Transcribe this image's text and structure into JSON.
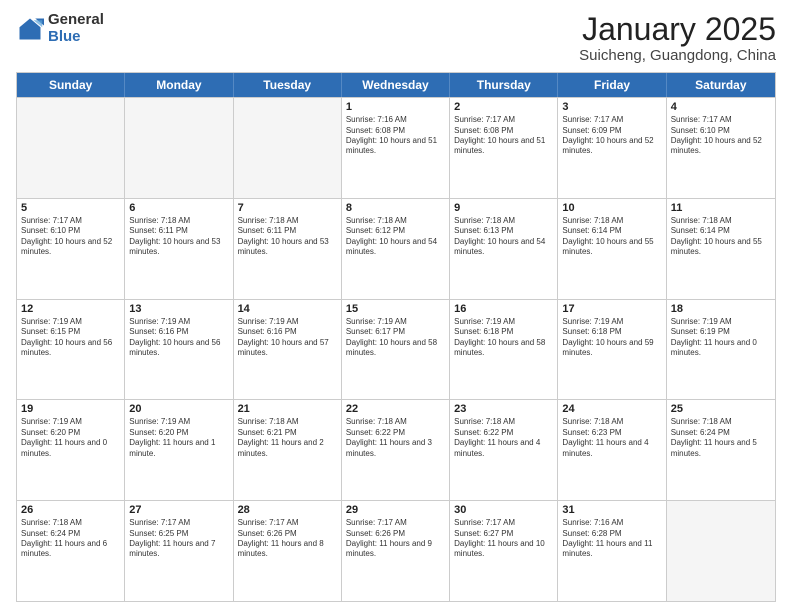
{
  "header": {
    "logo": {
      "general": "General",
      "blue": "Blue"
    },
    "title": "January 2025",
    "subtitle": "Suicheng, Guangdong, China"
  },
  "weekdays": [
    "Sunday",
    "Monday",
    "Tuesday",
    "Wednesday",
    "Thursday",
    "Friday",
    "Saturday"
  ],
  "weeks": [
    [
      {
        "day": "",
        "sunrise": "",
        "sunset": "",
        "daylight": "",
        "empty": true
      },
      {
        "day": "",
        "sunrise": "",
        "sunset": "",
        "daylight": "",
        "empty": true
      },
      {
        "day": "",
        "sunrise": "",
        "sunset": "",
        "daylight": "",
        "empty": true
      },
      {
        "day": "1",
        "sunrise": "Sunrise: 7:16 AM",
        "sunset": "Sunset: 6:08 PM",
        "daylight": "Daylight: 10 hours and 51 minutes.",
        "empty": false
      },
      {
        "day": "2",
        "sunrise": "Sunrise: 7:17 AM",
        "sunset": "Sunset: 6:08 PM",
        "daylight": "Daylight: 10 hours and 51 minutes.",
        "empty": false
      },
      {
        "day": "3",
        "sunrise": "Sunrise: 7:17 AM",
        "sunset": "Sunset: 6:09 PM",
        "daylight": "Daylight: 10 hours and 52 minutes.",
        "empty": false
      },
      {
        "day": "4",
        "sunrise": "Sunrise: 7:17 AM",
        "sunset": "Sunset: 6:10 PM",
        "daylight": "Daylight: 10 hours and 52 minutes.",
        "empty": false
      }
    ],
    [
      {
        "day": "5",
        "sunrise": "Sunrise: 7:17 AM",
        "sunset": "Sunset: 6:10 PM",
        "daylight": "Daylight: 10 hours and 52 minutes.",
        "empty": false
      },
      {
        "day": "6",
        "sunrise": "Sunrise: 7:18 AM",
        "sunset": "Sunset: 6:11 PM",
        "daylight": "Daylight: 10 hours and 53 minutes.",
        "empty": false
      },
      {
        "day": "7",
        "sunrise": "Sunrise: 7:18 AM",
        "sunset": "Sunset: 6:11 PM",
        "daylight": "Daylight: 10 hours and 53 minutes.",
        "empty": false
      },
      {
        "day": "8",
        "sunrise": "Sunrise: 7:18 AM",
        "sunset": "Sunset: 6:12 PM",
        "daylight": "Daylight: 10 hours and 54 minutes.",
        "empty": false
      },
      {
        "day": "9",
        "sunrise": "Sunrise: 7:18 AM",
        "sunset": "Sunset: 6:13 PM",
        "daylight": "Daylight: 10 hours and 54 minutes.",
        "empty": false
      },
      {
        "day": "10",
        "sunrise": "Sunrise: 7:18 AM",
        "sunset": "Sunset: 6:14 PM",
        "daylight": "Daylight: 10 hours and 55 minutes.",
        "empty": false
      },
      {
        "day": "11",
        "sunrise": "Sunrise: 7:18 AM",
        "sunset": "Sunset: 6:14 PM",
        "daylight": "Daylight: 10 hours and 55 minutes.",
        "empty": false
      }
    ],
    [
      {
        "day": "12",
        "sunrise": "Sunrise: 7:19 AM",
        "sunset": "Sunset: 6:15 PM",
        "daylight": "Daylight: 10 hours and 56 minutes.",
        "empty": false
      },
      {
        "day": "13",
        "sunrise": "Sunrise: 7:19 AM",
        "sunset": "Sunset: 6:16 PM",
        "daylight": "Daylight: 10 hours and 56 minutes.",
        "empty": false
      },
      {
        "day": "14",
        "sunrise": "Sunrise: 7:19 AM",
        "sunset": "Sunset: 6:16 PM",
        "daylight": "Daylight: 10 hours and 57 minutes.",
        "empty": false
      },
      {
        "day": "15",
        "sunrise": "Sunrise: 7:19 AM",
        "sunset": "Sunset: 6:17 PM",
        "daylight": "Daylight: 10 hours and 58 minutes.",
        "empty": false
      },
      {
        "day": "16",
        "sunrise": "Sunrise: 7:19 AM",
        "sunset": "Sunset: 6:18 PM",
        "daylight": "Daylight: 10 hours and 58 minutes.",
        "empty": false
      },
      {
        "day": "17",
        "sunrise": "Sunrise: 7:19 AM",
        "sunset": "Sunset: 6:18 PM",
        "daylight": "Daylight: 10 hours and 59 minutes.",
        "empty": false
      },
      {
        "day": "18",
        "sunrise": "Sunrise: 7:19 AM",
        "sunset": "Sunset: 6:19 PM",
        "daylight": "Daylight: 11 hours and 0 minutes.",
        "empty": false
      }
    ],
    [
      {
        "day": "19",
        "sunrise": "Sunrise: 7:19 AM",
        "sunset": "Sunset: 6:20 PM",
        "daylight": "Daylight: 11 hours and 0 minutes.",
        "empty": false
      },
      {
        "day": "20",
        "sunrise": "Sunrise: 7:19 AM",
        "sunset": "Sunset: 6:20 PM",
        "daylight": "Daylight: 11 hours and 1 minute.",
        "empty": false
      },
      {
        "day": "21",
        "sunrise": "Sunrise: 7:18 AM",
        "sunset": "Sunset: 6:21 PM",
        "daylight": "Daylight: 11 hours and 2 minutes.",
        "empty": false
      },
      {
        "day": "22",
        "sunrise": "Sunrise: 7:18 AM",
        "sunset": "Sunset: 6:22 PM",
        "daylight": "Daylight: 11 hours and 3 minutes.",
        "empty": false
      },
      {
        "day": "23",
        "sunrise": "Sunrise: 7:18 AM",
        "sunset": "Sunset: 6:22 PM",
        "daylight": "Daylight: 11 hours and 4 minutes.",
        "empty": false
      },
      {
        "day": "24",
        "sunrise": "Sunrise: 7:18 AM",
        "sunset": "Sunset: 6:23 PM",
        "daylight": "Daylight: 11 hours and 4 minutes.",
        "empty": false
      },
      {
        "day": "25",
        "sunrise": "Sunrise: 7:18 AM",
        "sunset": "Sunset: 6:24 PM",
        "daylight": "Daylight: 11 hours and 5 minutes.",
        "empty": false
      }
    ],
    [
      {
        "day": "26",
        "sunrise": "Sunrise: 7:18 AM",
        "sunset": "Sunset: 6:24 PM",
        "daylight": "Daylight: 11 hours and 6 minutes.",
        "empty": false
      },
      {
        "day": "27",
        "sunrise": "Sunrise: 7:17 AM",
        "sunset": "Sunset: 6:25 PM",
        "daylight": "Daylight: 11 hours and 7 minutes.",
        "empty": false
      },
      {
        "day": "28",
        "sunrise": "Sunrise: 7:17 AM",
        "sunset": "Sunset: 6:26 PM",
        "daylight": "Daylight: 11 hours and 8 minutes.",
        "empty": false
      },
      {
        "day": "29",
        "sunrise": "Sunrise: 7:17 AM",
        "sunset": "Sunset: 6:26 PM",
        "daylight": "Daylight: 11 hours and 9 minutes.",
        "empty": false
      },
      {
        "day": "30",
        "sunrise": "Sunrise: 7:17 AM",
        "sunset": "Sunset: 6:27 PM",
        "daylight": "Daylight: 11 hours and 10 minutes.",
        "empty": false
      },
      {
        "day": "31",
        "sunrise": "Sunrise: 7:16 AM",
        "sunset": "Sunset: 6:28 PM",
        "daylight": "Daylight: 11 hours and 11 minutes.",
        "empty": false
      },
      {
        "day": "",
        "sunrise": "",
        "sunset": "",
        "daylight": "",
        "empty": true
      }
    ]
  ]
}
